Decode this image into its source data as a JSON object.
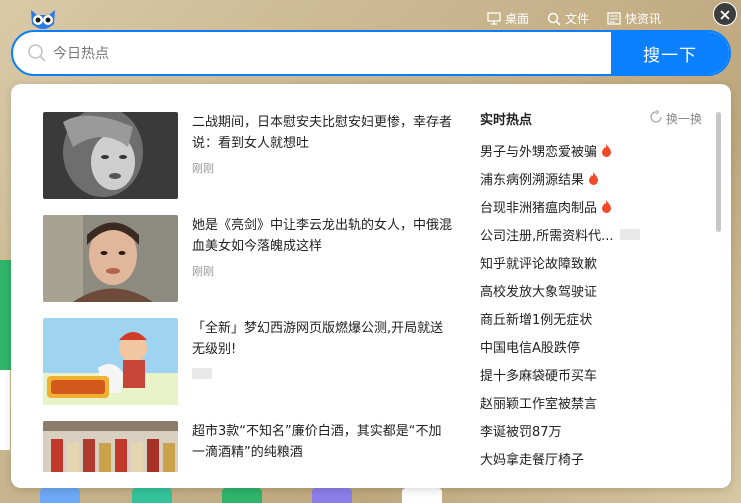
{
  "search": {
    "placeholder": "今日热点",
    "button_label": "搜一下"
  },
  "top_links": [
    {
      "label": "桌面",
      "icon": "monitor-icon"
    },
    {
      "label": "文件",
      "icon": "search-icon"
    },
    {
      "label": "快资讯",
      "icon": "news-icon"
    }
  ],
  "news": [
    {
      "title": "二战期间，日本慰安夫比慰安妇更惨，幸存者说：看到女人就想吐",
      "meta": "刚刚"
    },
    {
      "title": "她是《亮剑》中让李云龙出轨的女人，中俄混血美女如今落魄成这样",
      "meta": "刚刚"
    },
    {
      "title": "「全新」梦幻西游网页版燃爆公测,开局就送无级别!",
      "meta": ""
    },
    {
      "title": "超市3款“不知名”廉价白酒，其实都是“不加一滴酒精”的纯粮酒",
      "meta": ""
    }
  ],
  "hot": {
    "title": "实时热点",
    "refresh_label": "换一换",
    "items": [
      {
        "text": "男子与外甥恋爱被骗",
        "fire": true,
        "ad": false
      },
      {
        "text": "浦东病例溯源结果",
        "fire": true,
        "ad": false
      },
      {
        "text": "台现非洲猪瘟肉制品",
        "fire": true,
        "ad": false
      },
      {
        "text": "公司注册,所需资料代...",
        "fire": false,
        "ad": true
      },
      {
        "text": "知乎就评论故障致歉",
        "fire": false,
        "ad": false
      },
      {
        "text": "高校发放大象驾驶证",
        "fire": false,
        "ad": false
      },
      {
        "text": "商丘新增1例无症状",
        "fire": false,
        "ad": false
      },
      {
        "text": "中国电信A股跌停",
        "fire": false,
        "ad": false
      },
      {
        "text": "提十多麻袋硬币买车",
        "fire": false,
        "ad": false
      },
      {
        "text": "赵丽颖工作室被禁言",
        "fire": false,
        "ad": false
      },
      {
        "text": "李诞被罚87万",
        "fire": false,
        "ad": false
      },
      {
        "text": "大妈拿走餐厅椅子",
        "fire": false,
        "ad": false
      }
    ]
  },
  "colors": {
    "accent": "#0a80ff",
    "fire": "#f04a2a"
  }
}
